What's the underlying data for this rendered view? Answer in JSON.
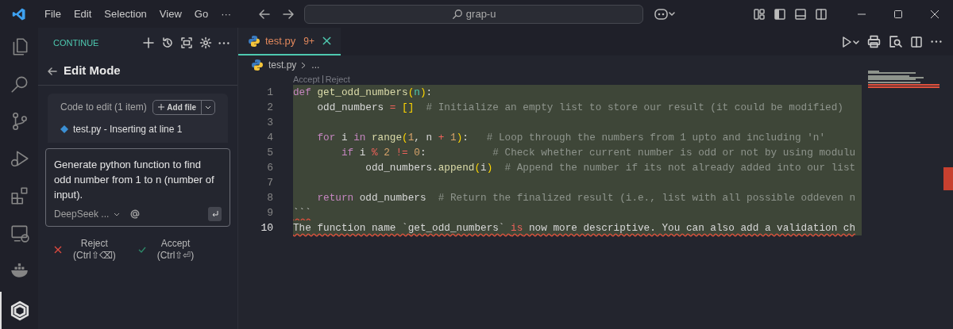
{
  "title_bar": {
    "menus": [
      "File",
      "Edit",
      "Selection",
      "View",
      "Go",
      "···"
    ],
    "search": "grap-u"
  },
  "activity_bar": {
    "items": [
      {
        "kind": "files",
        "selected": false
      },
      {
        "kind": "search",
        "selected": false
      },
      {
        "kind": "git",
        "selected": false
      },
      {
        "kind": "debug",
        "selected": false
      },
      {
        "kind": "extensions",
        "selected": false
      },
      {
        "kind": "remote",
        "selected": false
      },
      {
        "kind": "docker",
        "selected": false
      },
      {
        "kind": "continue",
        "selected": true
      }
    ]
  },
  "sidebar": {
    "header": "CONTINUE",
    "title": "Edit Mode",
    "code_to_edit": {
      "label": "Code to edit (1 item)",
      "add_button": "Add file",
      "files": [
        "test.py - Inserting at line 1"
      ]
    },
    "prompt": {
      "value": "Generate python function to find odd number from 1 to n (number of input).",
      "model": "DeepSeek ..."
    },
    "actions": [
      {
        "kind": "reject",
        "label": "Reject",
        "shortcut": "(Ctrl⇧⌫)"
      },
      {
        "kind": "accept",
        "label": "Accept",
        "shortcut": "(Ctrl⇧⏎)"
      }
    ]
  },
  "editor": {
    "tab": {
      "name": "test.py",
      "problems": "9+"
    },
    "breadcrumb": [
      "test.py",
      "..."
    ],
    "codelens": [
      "Accept",
      "Reject"
    ],
    "lines": [
      {
        "number": "1",
        "current": false,
        "squiggle": false,
        "tokens": [
          {
            "text": "def",
            "kind": "kw"
          },
          {
            "text": " get_odd_numbers",
            "kind": "fn"
          },
          {
            "text": "(",
            "kind": "br"
          },
          {
            "text": "n",
            "kind": "param"
          },
          {
            "text": ")",
            "kind": "br"
          },
          {
            "text": ":",
            "kind": "plain"
          }
        ]
      },
      {
        "number": "2",
        "current": false,
        "squiggle": false,
        "tokens": [
          {
            "text": "    odd_numbers ",
            "kind": "plain"
          },
          {
            "text": "=",
            "kind": "op"
          },
          {
            "text": " []",
            "kind": "br"
          },
          {
            "text": "  # Initialize an empty list to store our result (it could be modified)",
            "kind": "comment"
          }
        ]
      },
      {
        "number": "3",
        "current": false
      },
      {
        "number": "4",
        "current": false,
        "squiggle": false,
        "tokens": [
          {
            "text": "    for",
            "kind": "kw"
          },
          {
            "text": " i ",
            "kind": "plain"
          },
          {
            "text": "in",
            "kind": "kw"
          },
          {
            "text": " range",
            "kind": "fn"
          },
          {
            "text": "(",
            "kind": "br"
          },
          {
            "text": "1",
            "kind": "num"
          },
          {
            "text": ", n ",
            "kind": "plain"
          },
          {
            "text": "+",
            "kind": "op"
          },
          {
            "text": " 1",
            "kind": "num"
          },
          {
            "text": ")",
            "kind": "br"
          },
          {
            "text": ":",
            "kind": "plain"
          },
          {
            "text": "   # Loop through the numbers from 1 upto and including 'n'",
            "kind": "comment"
          }
        ]
      },
      {
        "number": "5",
        "current": false,
        "squiggle": false,
        "tokens": [
          {
            "text": "        if",
            "kind": "kw"
          },
          {
            "text": " i ",
            "kind": "plain"
          },
          {
            "text": "%",
            "kind": "op"
          },
          {
            "text": " 2",
            "kind": "num"
          },
          {
            "text": " !=",
            "kind": "op"
          },
          {
            "text": " 0",
            "kind": "num"
          },
          {
            "text": ":",
            "kind": "plain"
          },
          {
            "text": "           # Check whether current number is odd or not by using modulu",
            "kind": "comment"
          }
        ]
      },
      {
        "number": "6",
        "current": false,
        "squiggle": false,
        "tokens": [
          {
            "text": "            odd_numbers.",
            "kind": "plain"
          },
          {
            "text": "append",
            "kind": "fn"
          },
          {
            "text": "(",
            "kind": "br"
          },
          {
            "text": "i",
            "kind": "plain"
          },
          {
            "text": ")",
            "kind": "br"
          },
          {
            "text": "  # Append the number if its not already added into our list",
            "kind": "comment"
          }
        ]
      },
      {
        "number": "7",
        "current": false
      },
      {
        "number": "8",
        "current": false,
        "squiggle": false,
        "tokens": [
          {
            "text": "    return",
            "kind": "kw"
          },
          {
            "text": " odd_numbers",
            "kind": "plain"
          },
          {
            "text": "  # Return the finalized result (i.e., list with all possible oddeven n",
            "kind": "comment"
          }
        ]
      },
      {
        "number": "9",
        "current": false,
        "squiggle": true,
        "tokens": [
          {
            "text": "```",
            "kind": "plain"
          }
        ]
      },
      {
        "number": "10",
        "current": true,
        "squiggle": true,
        "tokens": [
          {
            "text": "The function name `get_odd_numbers` ",
            "kind": "plain"
          },
          {
            "text": "is",
            "kind": "op"
          },
          {
            "text": " now more descriptive. You can also add a validation ch",
            "kind": "plain"
          }
        ]
      }
    ]
  }
}
